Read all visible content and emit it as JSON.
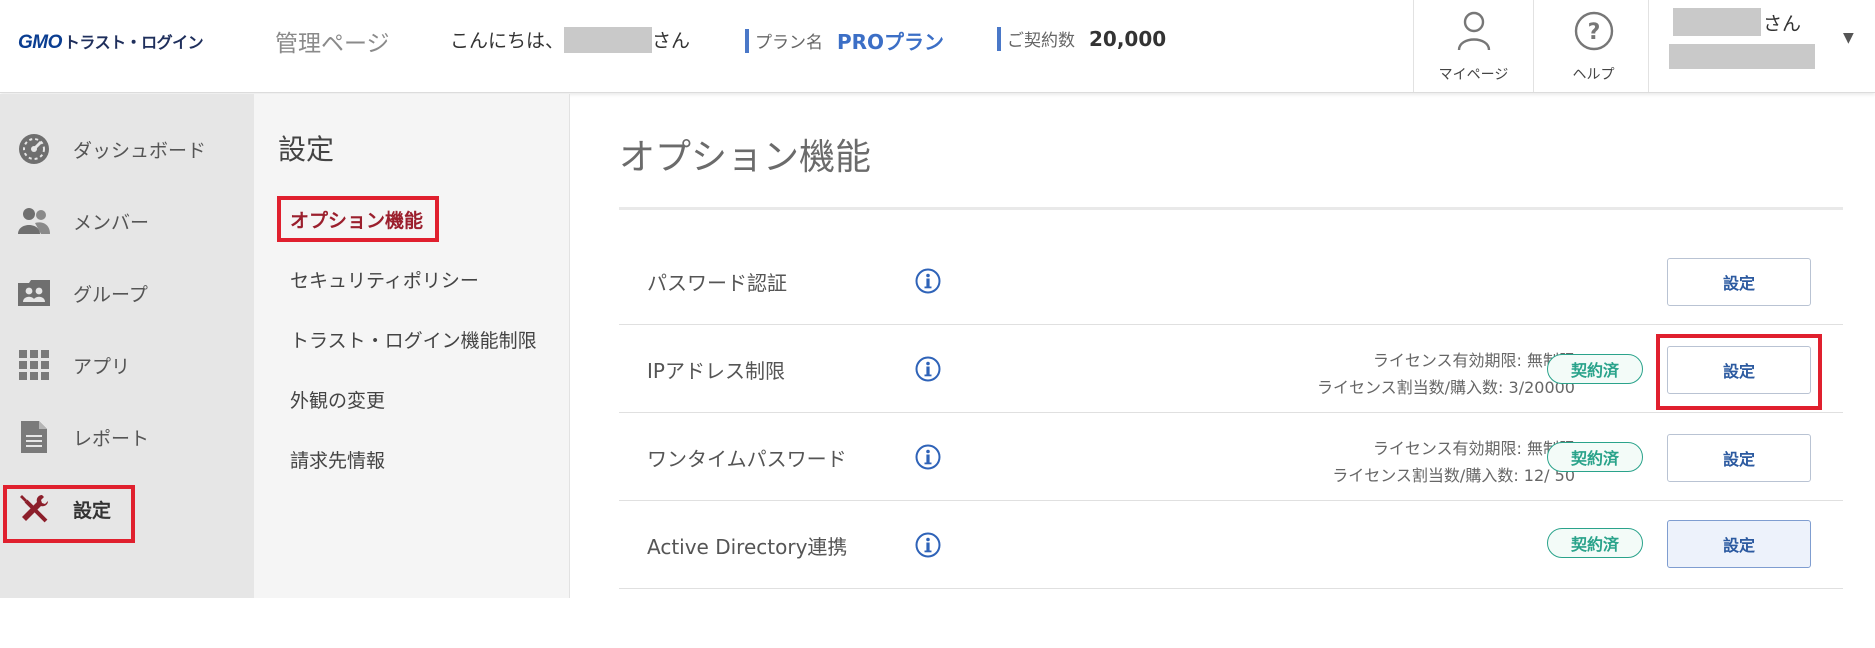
{
  "header": {
    "logo_gmo": "GMO",
    "logo_brand": "トラスト・ログイン",
    "admin_title": "管理ページ",
    "greeting_prefix": "こんにちは、",
    "greeting_suffix": "さん",
    "plan_label": "プラン名",
    "plan_value": "PROプラン",
    "contract_label": "ご契約数",
    "contract_value": "20,000",
    "mypage_label": "マイページ",
    "help_label": "ヘルプ",
    "user_suffix": "さん"
  },
  "sidebar": {
    "items": [
      {
        "label": "ダッシュボード",
        "icon": "dashboard-icon"
      },
      {
        "label": "メンバー",
        "icon": "members-icon"
      },
      {
        "label": "グループ",
        "icon": "group-icon"
      },
      {
        "label": "アプリ",
        "icon": "apps-grid-icon"
      },
      {
        "label": "レポート",
        "icon": "report-icon"
      },
      {
        "label": "設定",
        "icon": "tools-icon",
        "active": true
      }
    ]
  },
  "submenu": {
    "title": "設定",
    "items": [
      {
        "label": "オプション機能",
        "active": true
      },
      {
        "label": "セキュリティポリシー"
      },
      {
        "label": "トラスト・ログイン機能制限"
      },
      {
        "label": "外観の変更"
      },
      {
        "label": "請求先情報"
      }
    ]
  },
  "main": {
    "title": "オプション機能",
    "rows": [
      {
        "name": "パスワード認証",
        "button": "設定"
      },
      {
        "name": "IPアドレス制限",
        "license_period": "ライセンス有効期限: 無制限",
        "license_count": "ライセンス割当数/購入数: 3/20000",
        "badge": "契約済",
        "button": "設定"
      },
      {
        "name": "ワンタイムパスワード",
        "license_period": "ライセンス有効期限: 無制限",
        "license_count": "ライセンス割当数/購入数: 12/ 50",
        "badge": "契約済",
        "button": "設定"
      },
      {
        "name": "Active Directory連携",
        "badge": "契約済",
        "button": "設定"
      }
    ]
  },
  "colors": {
    "accent_blue": "#3c6fc6",
    "highlight_red": "#e0202e",
    "badge_green": "#2aa38b",
    "active_submenu": "#9b1f2d"
  }
}
